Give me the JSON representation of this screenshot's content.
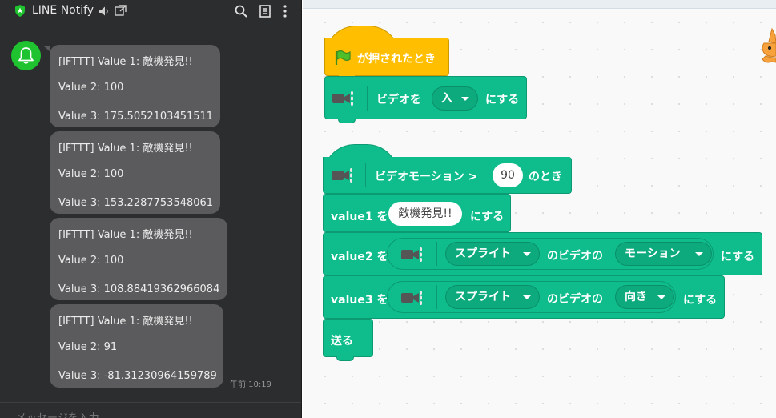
{
  "line": {
    "app_title": "LINE Notify",
    "messages": [
      {
        "line1": "[IFTTT] Value 1: 敵機発見!!",
        "line2": "Value 2: 100",
        "line3": "Value 3: 175.5052103451511"
      },
      {
        "line1": "[IFTTT] Value 1: 敵機発見!!",
        "line2": "Value 2: 100",
        "line3": "Value 3: 153.2287753548061"
      },
      {
        "line1": "[IFTTT] Value 1: 敵機発見!!",
        "line2": "Value 2: 100",
        "line3": "Value 3: 108.88419362966084"
      },
      {
        "line1": "[IFTTT] Value 1: 敵機発見!!",
        "line2": "Value 2: 91",
        "line3": "Value 3: -81.31230964159789"
      }
    ],
    "timestamp": "午前 10:19",
    "composer_placeholder": "メッセージを入力"
  },
  "scratch": {
    "script1": {
      "hat_label": "が押されたとき",
      "video_label": "ビデオを",
      "video_value": "入",
      "video_suffix": "にする"
    },
    "script2": {
      "hat_label": "ビデオモーション >",
      "hat_value": "90",
      "hat_suffix": "のとき",
      "value1_label": "value1 を",
      "value1_value": "敵機発見!!",
      "value1_suffix": "にする",
      "value2_label": "value2 を",
      "value2_sprite": "スプライト",
      "value2_mid": "のビデオの",
      "value2_attr": "モーション",
      "value2_suffix": "にする",
      "value3_label": "value3 を",
      "value3_sprite": "スプライト",
      "value3_mid": "のビデオの",
      "value3_attr": "向き",
      "value3_suffix": "にする",
      "send_label": "送る"
    }
  },
  "colors": {
    "extension": "#0fbd8c",
    "event": "#ffbf00",
    "line_green": "#1ec32f",
    "bubble": "#5b5b5d"
  }
}
